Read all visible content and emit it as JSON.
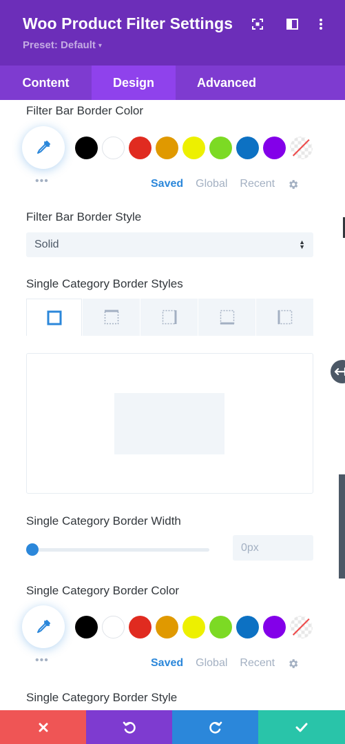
{
  "header": {
    "title": "Woo Product Filter Settings",
    "preset": "Preset: Default",
    "preset_caret": "▾"
  },
  "tabs": [
    {
      "label": "Content"
    },
    {
      "label": "Design",
      "active": true
    },
    {
      "label": "Advanced"
    }
  ],
  "filter_bar_border_color": {
    "label": "Filter Bar Border Color",
    "more": "•••",
    "swatches": [
      "#000000",
      "#ffffff",
      "#e02b20",
      "#e09900",
      "#edf000",
      "#7cda24",
      "#0c71c3",
      "#8300e9",
      "none"
    ],
    "tabs": {
      "saved": "Saved",
      "global": "Global",
      "recent": "Recent"
    }
  },
  "filter_bar_border_style": {
    "label": "Filter Bar Border Style",
    "value": "Solid"
  },
  "single_category_border_styles": {
    "label": "Single Category Border Styles",
    "sides": [
      "all",
      "top",
      "right",
      "bottom",
      "left"
    ]
  },
  "single_category_border_width": {
    "label": "Single Category Border Width",
    "slider_fraction": 0.0,
    "value": "0px"
  },
  "single_category_border_color": {
    "label": "Single Category Border Color",
    "more": "•••",
    "swatches": [
      "#000000",
      "#ffffff",
      "#e02b20",
      "#e09900",
      "#edf000",
      "#7cda24",
      "#0c71c3",
      "#8300e9",
      "none"
    ],
    "tabs": {
      "saved": "Saved",
      "global": "Global",
      "recent": "Recent"
    }
  },
  "single_category_border_style": {
    "label": "Single Category Border Style"
  },
  "footer": {
    "cancel_color": "#ef5555",
    "undo_color": "#7e3bd0",
    "redo_color": "#2b87da",
    "save_color": "#29c4a9"
  },
  "colors": {
    "accent": "#2b87da",
    "header": "#6c2eb9",
    "tab_bar": "#7e3bd0",
    "active_tab": "#8f42ec"
  }
}
